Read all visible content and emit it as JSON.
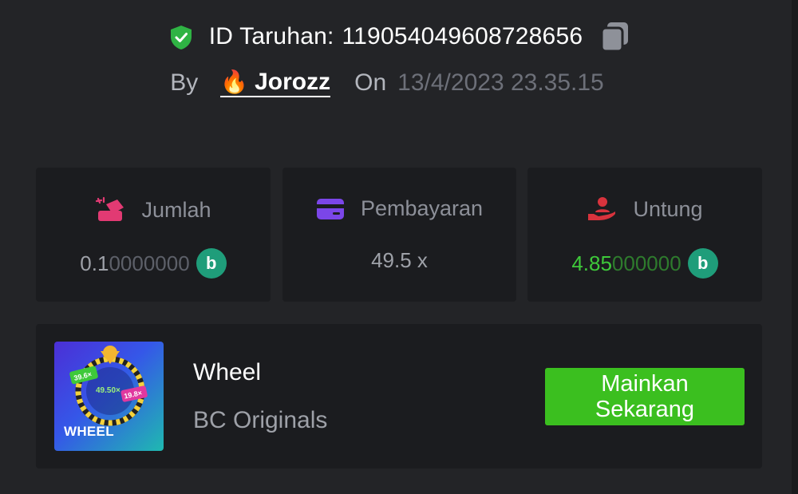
{
  "bet": {
    "id_label": "ID Taruhan:",
    "id_value": "119054049608728656",
    "by_label": "By",
    "username": "Jorozz",
    "on_label": "On",
    "date": "13/4/2023 23.35.15"
  },
  "stats": [
    {
      "label": "Jumlah",
      "value_main": "0.1",
      "value_faded": "0000000",
      "icon": "bet-amount-icon",
      "coin": true
    },
    {
      "label": "Pembayaran",
      "value_main": "49.5 x",
      "value_faded": "",
      "icon": "card-icon",
      "coin": false
    },
    {
      "label": "Untung",
      "value_main": "4.85",
      "value_faded": "000000",
      "icon": "profit-hand-icon",
      "coin": true
    }
  ],
  "game": {
    "thumb_text": "WHEEL",
    "thumb_mult_center": "49.50×",
    "thumb_mult_left": "39.6×",
    "thumb_mult_right": "19.8×",
    "title": "Wheel",
    "provider": "BC Originals",
    "play_label": "Mainkan\nSekarang"
  },
  "coin_symbol": "b",
  "colors": {
    "background": "#232427",
    "card": "#1b1c1f",
    "accent_green": "#3bbf1f",
    "profit_green": "#3ec93a",
    "shield_green": "#2fb344",
    "coin_teal": "#1f9d7a",
    "icon_pink": "#e23a73",
    "icon_purple": "#7b46e8",
    "icon_red": "#d8333d"
  }
}
